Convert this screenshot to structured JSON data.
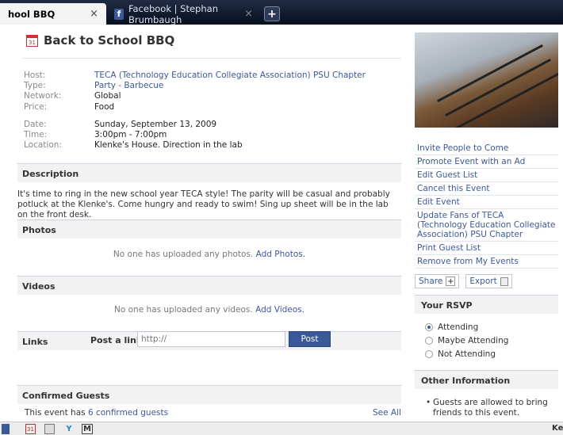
{
  "tabs": [
    {
      "label": "hool BBQ",
      "close": "×"
    },
    {
      "label": "Facebook | Stephan Brumbaugh",
      "close": "×",
      "icon": "facebook-icon"
    }
  ],
  "new_tab": "+",
  "event": {
    "title": "Back to School BBQ",
    "host_label": "Host:",
    "host": "TECA (Technology Education Collegiate Association) PSU Chapter",
    "type_label": "Type:",
    "type": "Party - Barbecue",
    "network_label": "Network:",
    "network": "Global",
    "price_label": "Price:",
    "price": "Food",
    "date_label": "Date:",
    "date": "Sunday, September 13, 2009",
    "time_label": "Time:",
    "time": "3:00pm - 7:00pm",
    "location_label": "Location:",
    "location": "Klenke's House. Direction in the lab"
  },
  "sections": {
    "description": "Description",
    "description_text": "It's time to ring in the new school year TECA style! The parity will be casual and probably potluck at the Klenke's. Come hungry and ready to swim! Sing up sheet will be in the lab on the front desk.",
    "photos": "Photos",
    "photos_empty": "No one has uploaded any photos.",
    "photos_link": "Add Photos.",
    "videos": "Videos",
    "videos_empty": "No one has uploaded any videos.",
    "videos_link": "Add Videos.",
    "links": "Links",
    "post_label": "Post a link:",
    "post_placeholder": "http://",
    "post_button": "Post",
    "guests": "Confirmed Guests",
    "guests_prefix": "This event has",
    "guests_link": "6 confirmed guests",
    "see_all": "See All"
  },
  "actions": [
    "Invite People to Come",
    "Promote Event with an Ad",
    "Edit Guest List",
    "Cancel this Event",
    "Edit Event",
    "Update Fans of TECA (Technology Education Collegiate Association) PSU Chapter",
    "Print Guest List",
    "Remove from My Events"
  ],
  "share": {
    "label": "Share",
    "plus": "+"
  },
  "export": {
    "label": "Export"
  },
  "rsvp": {
    "title": "Your RSVP",
    "options": [
      "Attending",
      "Maybe Attending",
      "Not Attending"
    ],
    "selected": "Attending"
  },
  "other_info": {
    "title": "Other Information",
    "bullet": "Guests are allowed to bring friends to this event."
  },
  "bottombar": {
    "icon_cal_text": "31",
    "icon_m_text": "M",
    "right_text": "Ke"
  },
  "colors": {
    "link": "#3b5998",
    "tabbar": "#101a2c"
  }
}
